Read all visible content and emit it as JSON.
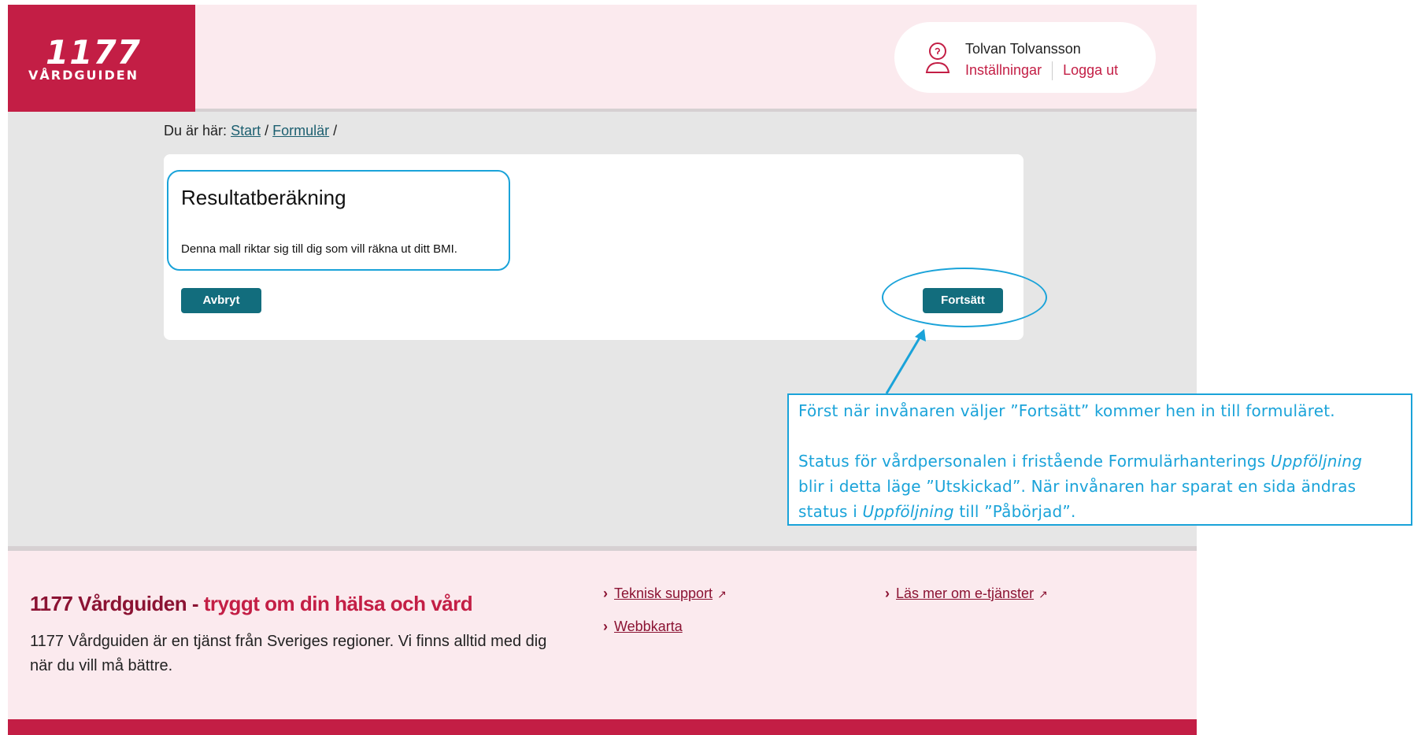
{
  "header": {
    "logo_number": "1177",
    "logo_text": "VÅRDGUIDEN",
    "user_name": "Tolvan Tolvansson",
    "settings_label": "Inställningar",
    "logout_label": "Logga ut"
  },
  "breadcrumb": {
    "prefix": "Du är här:",
    "start": "Start",
    "sep1": "/",
    "forms": "Formulär",
    "sep2": "/"
  },
  "card": {
    "title": "Resultatberäkning",
    "description": "Denna mall riktar sig till dig som vill räkna ut ditt BMI.",
    "cancel_label": "Avbryt",
    "continue_label": "Fortsätt"
  },
  "annotation": {
    "line1": "Först när invånaren väljer ”Fortsätt” kommer hen in till formuläret.",
    "line2_a": "Status för vårdpersonalen i fristående Formulärhanterings ",
    "line2_em": "Uppföljning",
    "line3": "blir i detta läge ”Utskickad”. När invånaren har sparat en sida ändras",
    "line4_a": "status i ",
    "line4_em": "Uppföljning",
    "line4_b": " till ”Påbörjad”."
  },
  "footer": {
    "title_main": "1177 Vårdguiden - ",
    "title_accent": "tryggt om din hälsa och vård",
    "description": "1177 Vårdguiden är en tjänst från Sveriges regioner. Vi finns alltid med dig när du vill må bättre.",
    "links": {
      "support": "Teknisk support",
      "sitemap": "Webbkarta",
      "eservices": "Läs mer om e-tjänster"
    }
  },
  "colors": {
    "brand": "#c31e45",
    "button": "#126d7d",
    "annotation": "#1aa3d9",
    "header_bg": "#fbeaee",
    "main_bg": "#e6e6e6"
  },
  "icons": [
    "user-icon",
    "chevron-right-icon",
    "external-link-icon",
    "arrow-pointer"
  ]
}
